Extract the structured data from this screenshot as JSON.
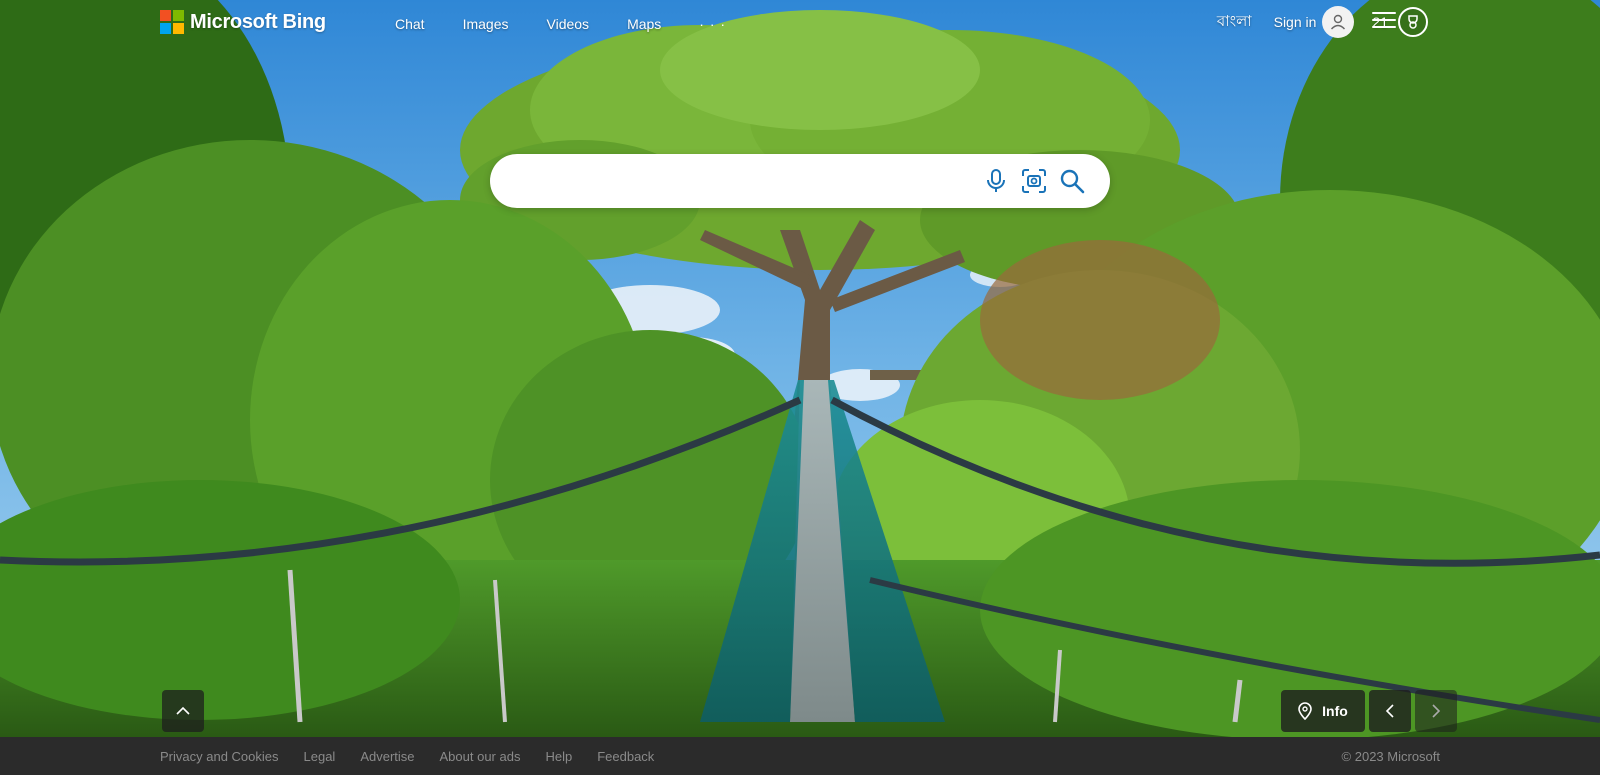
{
  "header": {
    "logo_text": "Microsoft Bing",
    "nav": [
      "Chat",
      "Images",
      "Videos",
      "Maps"
    ],
    "more_label": "· · ·",
    "language": "বাংলা",
    "signin_label": "Sign in",
    "reward_points": "21"
  },
  "search": {
    "value": "",
    "placeholder": ""
  },
  "image_info": {
    "info_label": "Info"
  },
  "footer": {
    "links": [
      "Privacy and Cookies",
      "Legal",
      "Advertise",
      "About our ads",
      "Help",
      "Feedback"
    ],
    "copyright": "© 2023 Microsoft"
  },
  "colors": {
    "ms_red": "#f25022",
    "ms_green": "#7fba00",
    "ms_blue": "#00a4ef",
    "ms_yellow": "#ffb900",
    "search_icon": "#1a73b8",
    "footer_bg": "#2b2b2b"
  },
  "icons": [
    "microphone-icon",
    "visual-search-icon",
    "search-icon",
    "avatar-icon",
    "rewards-icon",
    "hamburger-icon",
    "chevron-up-icon",
    "location-pin-icon",
    "chevron-left-icon",
    "chevron-right-icon"
  ]
}
